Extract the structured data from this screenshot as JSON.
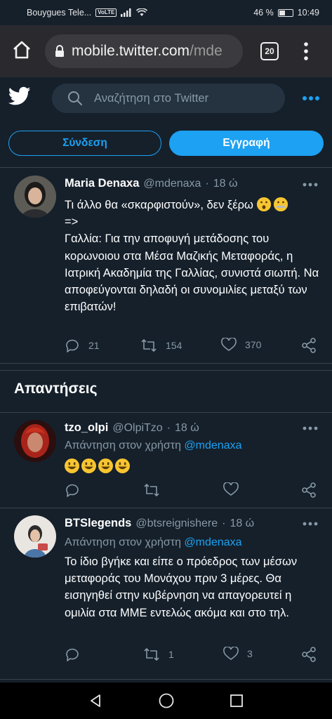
{
  "status_bar": {
    "carrier": "Bouygues Tele...",
    "volte": "VoLTE",
    "battery_percent_text": "46 %",
    "battery_level": 0.46,
    "time": "10:49"
  },
  "browser": {
    "url_host": "mobile.twitter.com",
    "url_path": "/mde",
    "tab_count": "20",
    "icons": [
      "home-icon",
      "lock-icon",
      "tabs-icon",
      "kebab-menu-icon"
    ]
  },
  "twitter_header": {
    "search_placeholder": "Αναζήτηση στο Twitter",
    "login_label": "Σύνδεση",
    "signup_label": "Εγγραφή",
    "accent_color": "#1da1f2",
    "background_color": "#15202b"
  },
  "main_tweet": {
    "name": "Maria Denaxa",
    "handle": "@mdenaxa",
    "separator": "·",
    "time": "18 ώ",
    "text_line1": "Τι άλλο θα «σκαρφιστούν», δεν ξέρω",
    "text_line2": "=>",
    "text_rest": "Γαλλία: Για την αποφυγή μετάδοσης του κορωνοιου στα Μέσα Μαζικής Μεταφοράς, η Ιατρική Ακαδημία της Γαλλίας, συνιστά σιωπή. Να αποφεύγονται δηλαδή οι συνομιλίες μεταξύ των επιβατών!",
    "replies": "21",
    "retweets": "154",
    "likes": "370"
  },
  "replies_section": {
    "title": "Απαντήσεις",
    "items": [
      {
        "name": "tzo_olpi",
        "handle": "@OlpiTzo",
        "time": "18 ώ",
        "reply_prefix": "Απάντηση στον χρήστη ",
        "reply_to": "@mdenaxa",
        "text": "",
        "replies": "",
        "retweets": "",
        "likes": ""
      },
      {
        "name": "BTSlegends",
        "handle": "@btsreignishere",
        "time": "18 ώ",
        "reply_prefix": "Απάντηση στον χρήστη ",
        "reply_to": "@mdenaxa",
        "text": "Το ίδιο βγήκε και είπε ο πρόεδρος των μέσων μεταφοράς του Μονάχου πριν 3 μέρες. Θα εισηγηθεί στην κυβέρνηση να απαγορευτεί η ομιλία στα ΜΜΕ εντελώς ακόμα και στο τηλ.",
        "replies": "",
        "retweets": "1",
        "likes": "3"
      }
    ]
  }
}
